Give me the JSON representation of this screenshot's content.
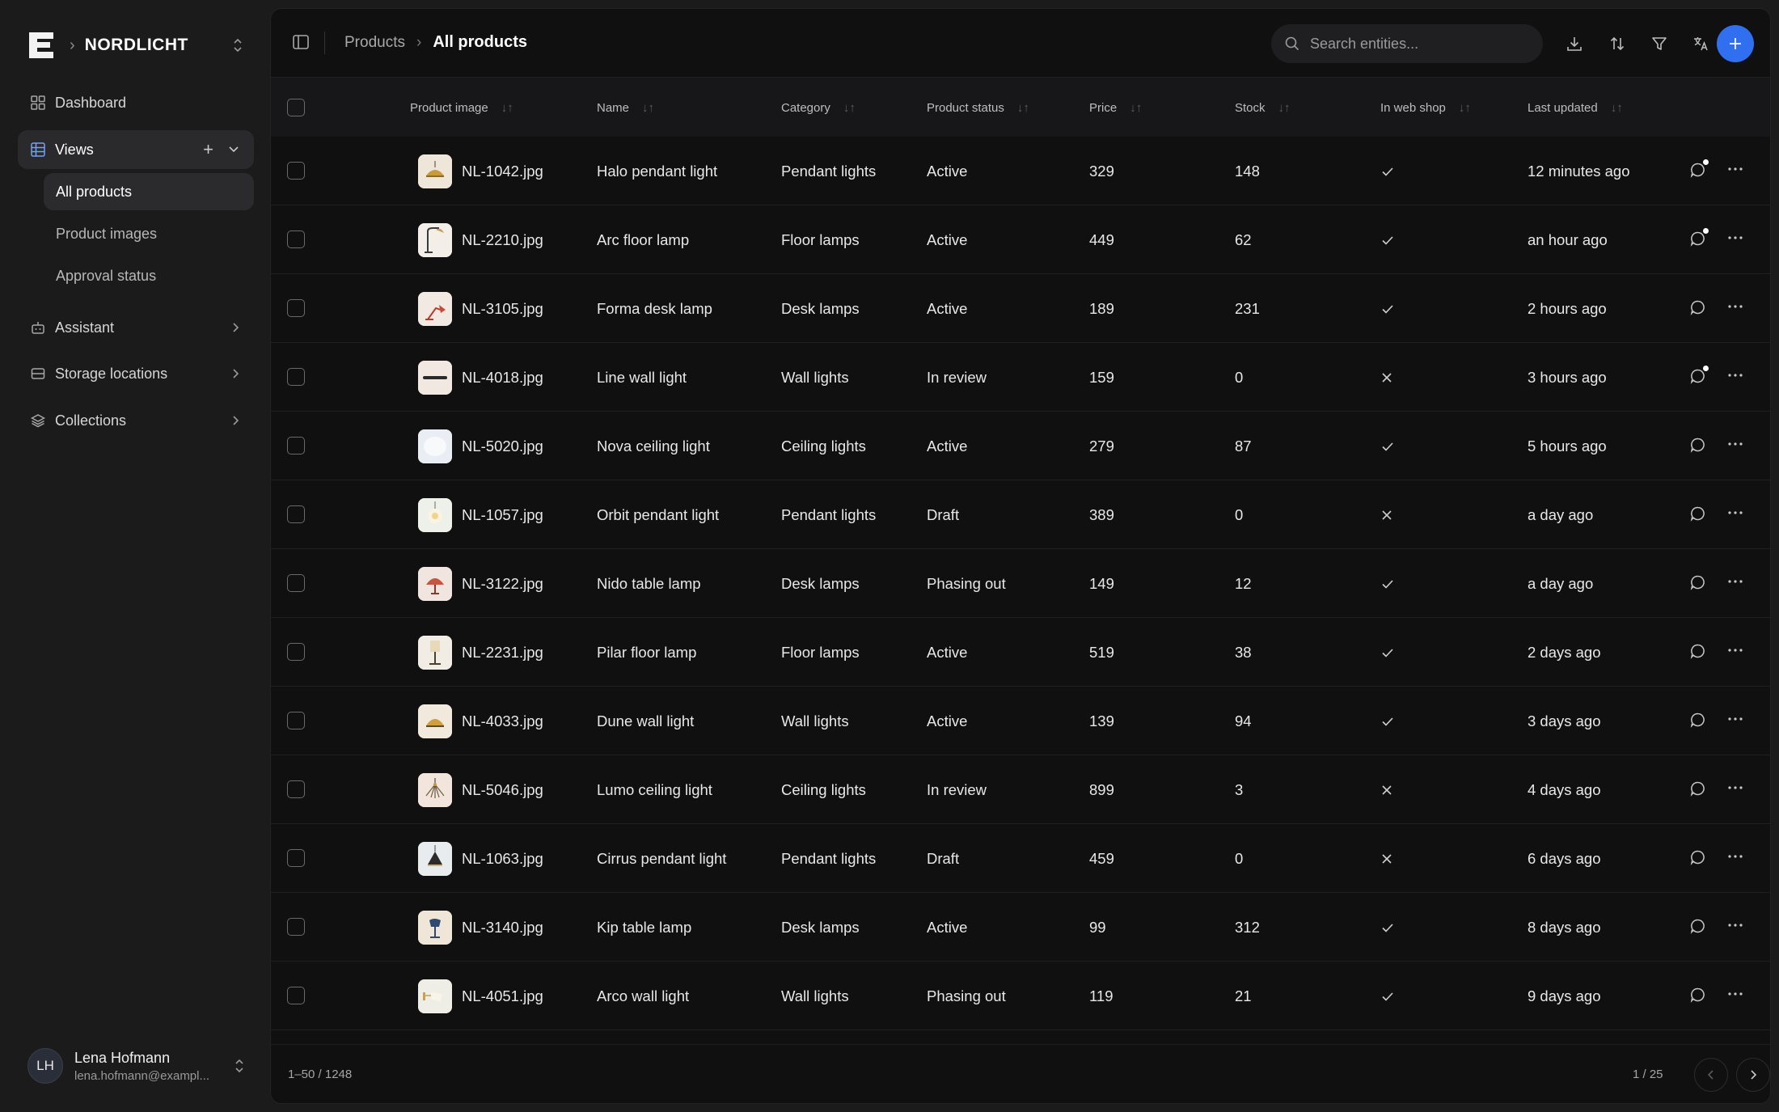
{
  "sidebar": {
    "brand": "NORDLICHT",
    "nav": {
      "dashboard": "Dashboard",
      "views": "Views",
      "assistant": "Assistant",
      "storage": "Storage locations",
      "collections": "Collections"
    },
    "views_items": [
      "All products",
      "Product images",
      "Approval status"
    ],
    "user": {
      "initials": "LH",
      "name": "Lena Hofmann",
      "email": "lena.hofmann@exampl..."
    }
  },
  "header": {
    "breadcrumb_parent": "Products",
    "breadcrumb_current": "All products",
    "search_placeholder": "Search entities..."
  },
  "table": {
    "columns": [
      "Product image",
      "Name",
      "Category",
      "Product status",
      "Price",
      "Stock",
      "In web shop",
      "Last updated"
    ],
    "rows": [
      {
        "image": "NL-1042.jpg",
        "name": "Halo pendant light",
        "category": "Pendant lights",
        "status": "Active",
        "price": "329",
        "stock": "148",
        "web": "check",
        "updated": "12 minutes ago",
        "comment_dot": true
      },
      {
        "image": "NL-2210.jpg",
        "name": "Arc floor lamp",
        "category": "Floor lamps",
        "status": "Active",
        "price": "449",
        "stock": "62",
        "web": "check",
        "updated": "an hour ago",
        "comment_dot": true
      },
      {
        "image": "NL-3105.jpg",
        "name": "Forma desk lamp",
        "category": "Desk lamps",
        "status": "Active",
        "price": "189",
        "stock": "231",
        "web": "check",
        "updated": "2 hours ago",
        "comment_dot": false
      },
      {
        "image": "NL-4018.jpg",
        "name": "Line wall light",
        "category": "Wall lights",
        "status": "In review",
        "price": "159",
        "stock": "0",
        "web": "cross",
        "updated": "3 hours ago",
        "comment_dot": true
      },
      {
        "image": "NL-5020.jpg",
        "name": "Nova ceiling light",
        "category": "Ceiling lights",
        "status": "Active",
        "price": "279",
        "stock": "87",
        "web": "check",
        "updated": "5 hours ago",
        "comment_dot": false
      },
      {
        "image": "NL-1057.jpg",
        "name": "Orbit pendant light",
        "category": "Pendant lights",
        "status": "Draft",
        "price": "389",
        "stock": "0",
        "web": "cross",
        "updated": "a day ago",
        "comment_dot": false
      },
      {
        "image": "NL-3122.jpg",
        "name": "Nido table lamp",
        "category": "Desk lamps",
        "status": "Phasing out",
        "price": "149",
        "stock": "12",
        "web": "check",
        "updated": "a day ago",
        "comment_dot": false
      },
      {
        "image": "NL-2231.jpg",
        "name": "Pilar floor lamp",
        "category": "Floor lamps",
        "status": "Active",
        "price": "519",
        "stock": "38",
        "web": "check",
        "updated": "2 days ago",
        "comment_dot": false
      },
      {
        "image": "NL-4033.jpg",
        "name": "Dune wall light",
        "category": "Wall lights",
        "status": "Active",
        "price": "139",
        "stock": "94",
        "web": "check",
        "updated": "3 days ago",
        "comment_dot": false
      },
      {
        "image": "NL-5046.jpg",
        "name": "Lumo ceiling light",
        "category": "Ceiling lights",
        "status": "In review",
        "price": "899",
        "stock": "3",
        "web": "cross",
        "updated": "4 days ago",
        "comment_dot": false
      },
      {
        "image": "NL-1063.jpg",
        "name": "Cirrus pendant light",
        "category": "Pendant lights",
        "status": "Draft",
        "price": "459",
        "stock": "0",
        "web": "cross",
        "updated": "6 days ago",
        "comment_dot": false
      },
      {
        "image": "NL-3140.jpg",
        "name": "Kip table lamp",
        "category": "Desk lamps",
        "status": "Active",
        "price": "99",
        "stock": "312",
        "web": "check",
        "updated": "8 days ago",
        "comment_dot": false
      },
      {
        "image": "NL-4051.jpg",
        "name": "Arco wall light",
        "category": "Wall lights",
        "status": "Phasing out",
        "price": "119",
        "stock": "21",
        "web": "check",
        "updated": "9 days ago",
        "comment_dot": false
      }
    ]
  },
  "footer": {
    "range": "1–50 / 1248",
    "page": "1 / 25"
  },
  "colors": {
    "accent": "#2f6ff0",
    "background": "#101011",
    "sidebar": "#1b1b1c"
  }
}
